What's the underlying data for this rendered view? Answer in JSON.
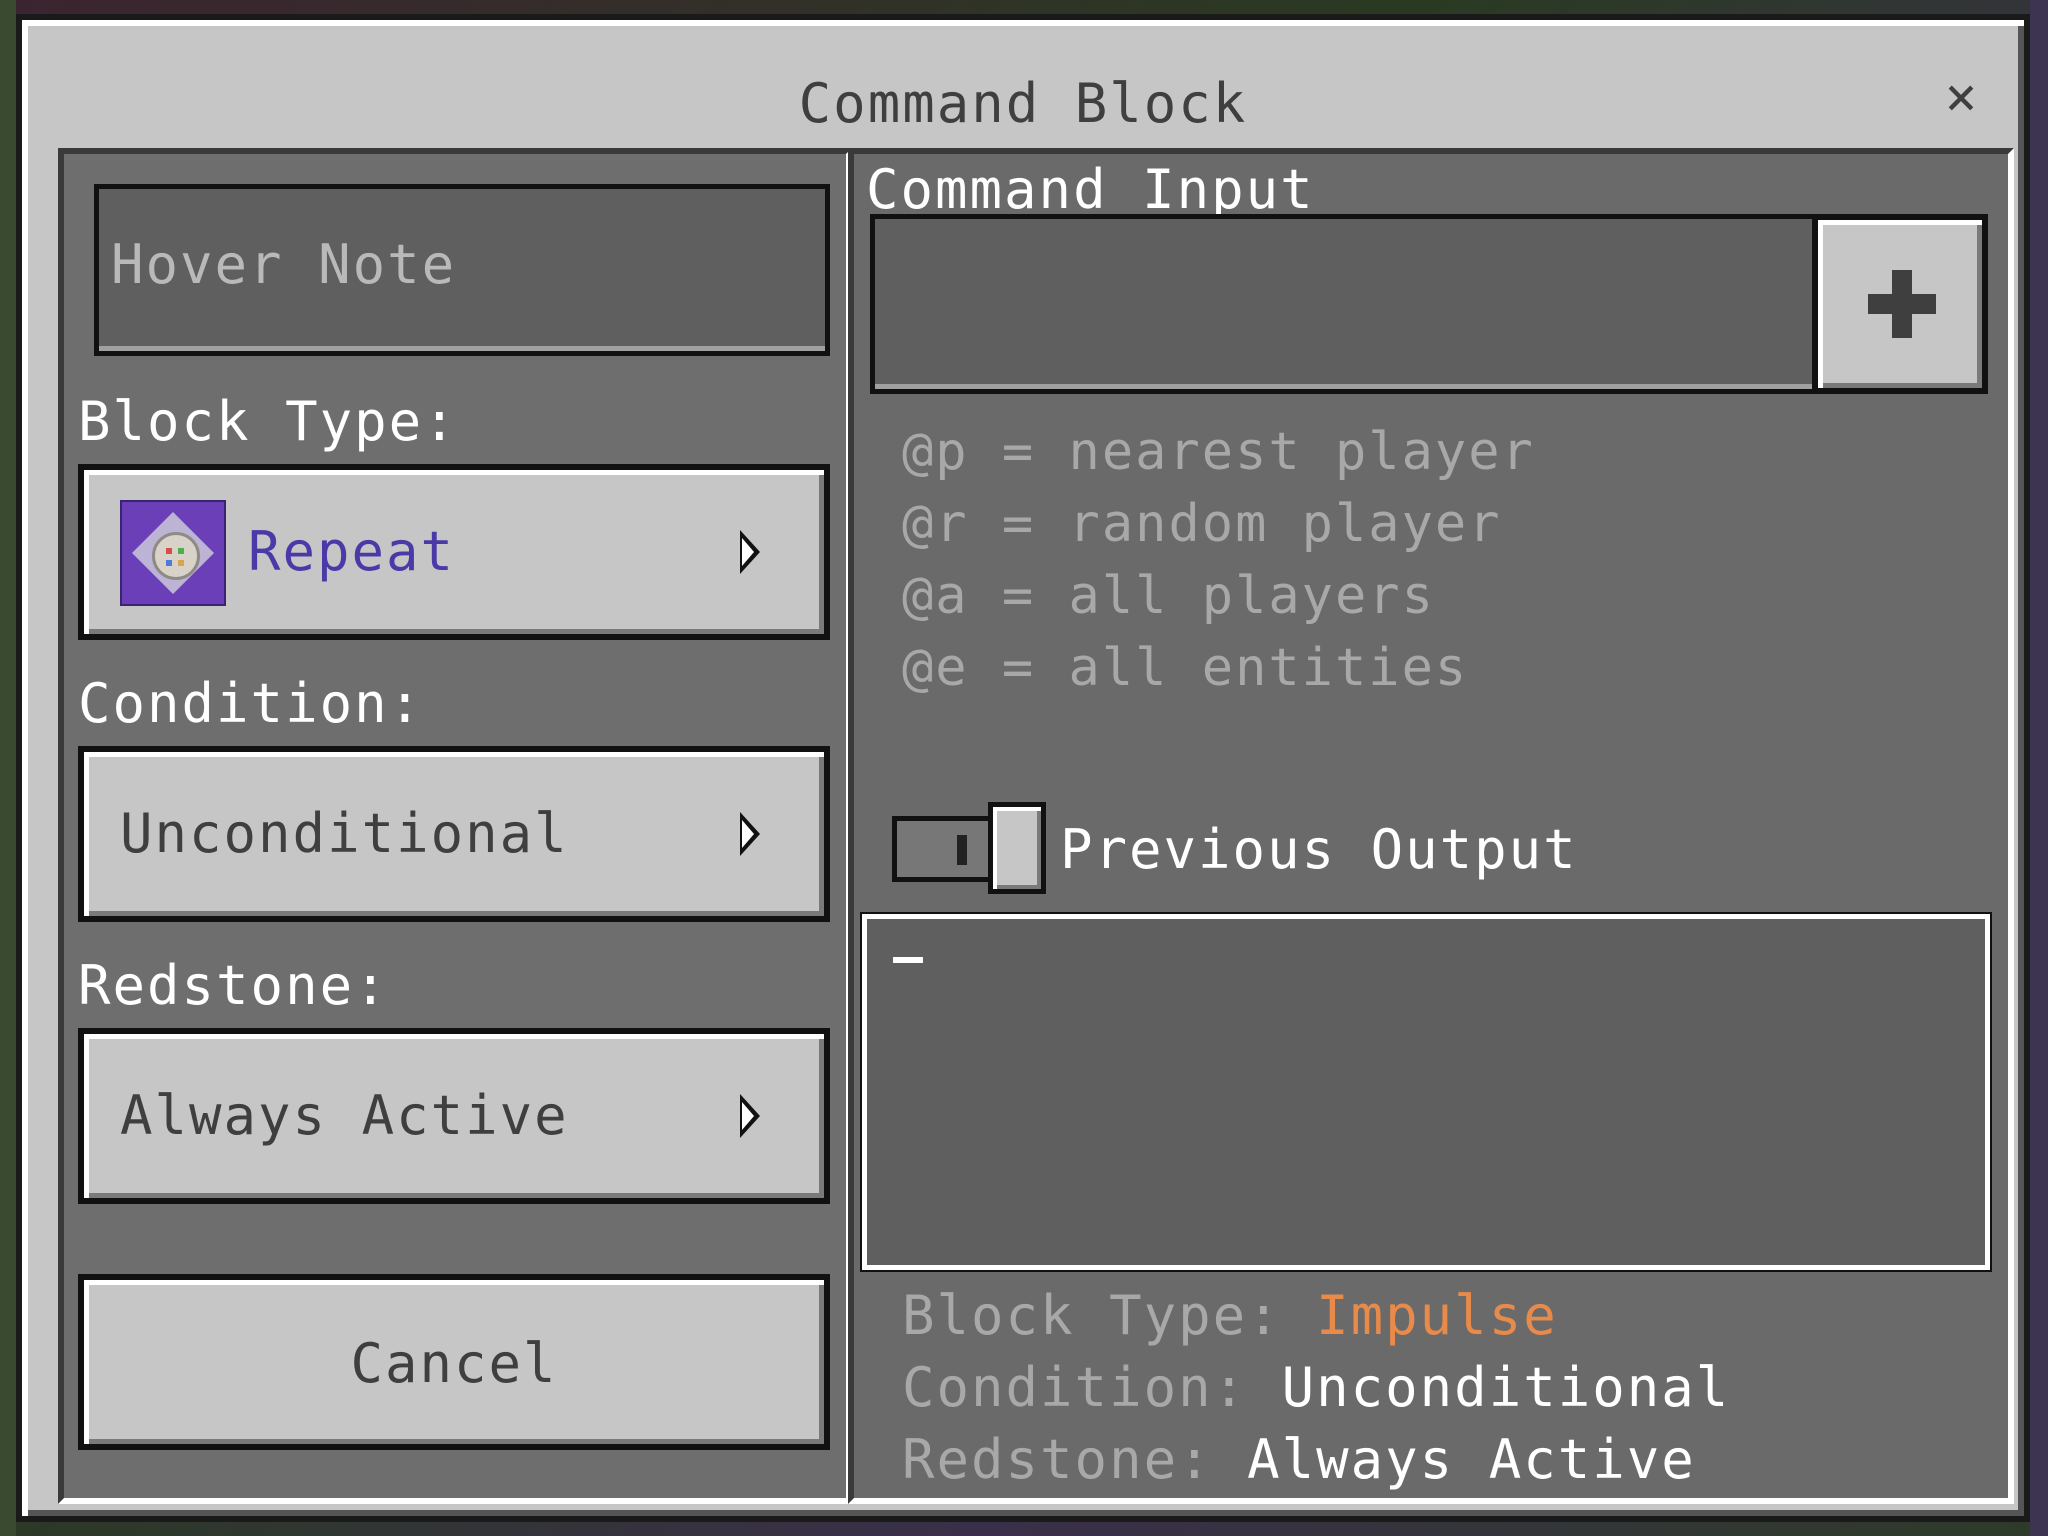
{
  "dialog": {
    "title": "Command Block",
    "close_label": "×"
  },
  "left": {
    "hover_note_placeholder": "Hover Note",
    "block_type_label": "Block Type:",
    "block_type_value": "Repeat",
    "condition_label": "Condition:",
    "condition_value": "Unconditional",
    "redstone_label": "Redstone:",
    "redstone_value": "Always Active",
    "cancel_label": "Cancel"
  },
  "right": {
    "command_input_label": "Command Input",
    "command_value": "",
    "hints": [
      "@p = nearest player",
      "@r = random player",
      "@a = all players",
      "@e = all entities"
    ],
    "previous_output_label": "Previous Output",
    "previous_output_enabled": true,
    "output_text": "",
    "status": {
      "block_type_key": "Block Type:",
      "block_type_val": "Impulse",
      "condition_key": "Condition:",
      "condition_val": "Unconditional",
      "redstone_key": "Redstone:",
      "redstone_val": "Always Active"
    }
  },
  "colors": {
    "accent_repeat": "#4a3aa8",
    "accent_impulse": "#e88a4a",
    "panel": "#6e6e6e",
    "button": "#c6c6c6"
  },
  "icons": {
    "block_type": "repeat-command-block-icon",
    "dropdown": "chevron-right-icon",
    "add": "plus-icon",
    "close": "close-icon"
  }
}
